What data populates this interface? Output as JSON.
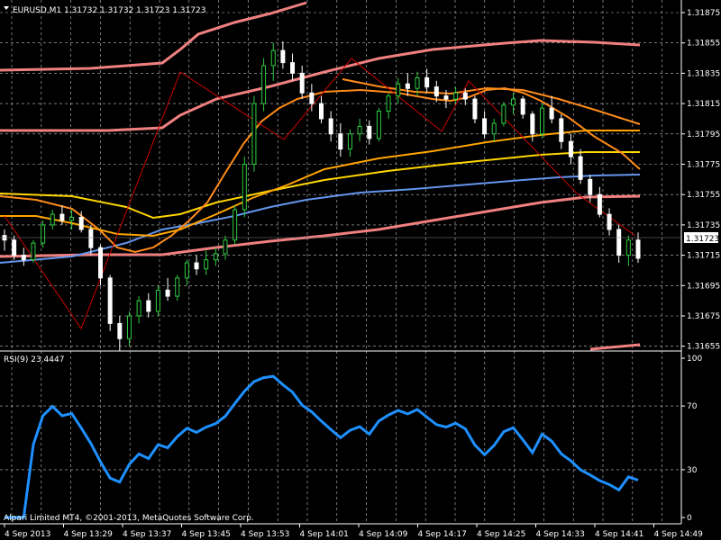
{
  "header": {
    "dropdown_icon": "triangle-down-icon",
    "text": "EURUSD,M1  1.31732 1.31732 1.31723 1.31723"
  },
  "rsi": {
    "label": "RSI(9) 23.4447",
    "value": 23.4447,
    "levels": [
      30,
      70
    ],
    "scale": [
      "100",
      "70",
      "30",
      "0"
    ]
  },
  "copyright": "Alpari Limited MT4, ©2001-2013, MetaQuotes Software Corp.",
  "price_axis": [
    "1.31875",
    "1.31855",
    "1.31835",
    "1.31815",
    "1.31795",
    "1.31775",
    "1.31755",
    "1.31735",
    "1.31715",
    "1.31695",
    "1.31675",
    "1.31655"
  ],
  "current_price": "1.31723",
  "time_axis": [
    "4 Sep 2013",
    "4 Sep 13:29",
    "4 Sep 13:37",
    "4 Sep 13:45",
    "4 Sep 13:53",
    "4 Sep 14:01",
    "4 Sep 14:09",
    "4 Sep 14:17",
    "4 Sep 14:25",
    "4 Sep 14:33",
    "4 Sep 14:41",
    "4 Sep 14:49"
  ],
  "colors": {
    "background": "#000000",
    "grid": "#c0c0c0",
    "bull_candle": "#2ecc40",
    "bear_candle": "#ffffff",
    "rsi_line": "#1e90ff",
    "zigzag": "#cc0000",
    "bands": "#f08080",
    "ma_orange": "#ff8c1a",
    "ma_gold": "#ffd700",
    "ma_blue": "#6495ed"
  },
  "chart_data": {
    "type": "candlestick",
    "symbol": "EURUSD",
    "timeframe": "M1",
    "ylim": [
      1.31645,
      1.31885
    ],
    "candles_ohlc": [
      [
        1.31738,
        1.31742,
        1.31728,
        1.31735
      ],
      [
        1.31735,
        1.31738,
        1.31722,
        1.31725
      ],
      [
        1.31725,
        1.3173,
        1.31718,
        1.31722
      ],
      [
        1.31722,
        1.31735,
        1.3172,
        1.31733
      ],
      [
        1.31733,
        1.31748,
        1.3173,
        1.31745
      ],
      [
        1.31745,
        1.31755,
        1.31742,
        1.31752
      ],
      [
        1.31752,
        1.31758,
        1.31745,
        1.31748
      ],
      [
        1.31748,
        1.31755,
        1.31742,
        1.3175
      ],
      [
        1.3175,
        1.31754,
        1.3174,
        1.31742
      ],
      [
        1.31742,
        1.31745,
        1.31725,
        1.3173
      ],
      [
        1.3173,
        1.31732,
        1.31705,
        1.3171
      ],
      [
        1.3171,
        1.31712,
        1.31675,
        1.3168
      ],
      [
        1.3168,
        1.31685,
        1.31662,
        1.3167
      ],
      [
        1.3167,
        1.31688,
        1.31665,
        1.31685
      ],
      [
        1.31685,
        1.31698,
        1.3168,
        1.31695
      ],
      [
        1.31695,
        1.317,
        1.31684,
        1.31688
      ],
      [
        1.31688,
        1.31705,
        1.31685,
        1.31702
      ],
      [
        1.31702,
        1.3171,
        1.31695,
        1.31698
      ],
      [
        1.31698,
        1.31712,
        1.31695,
        1.3171
      ],
      [
        1.3171,
        1.31722,
        1.31705,
        1.3172
      ],
      [
        1.3172,
        1.31725,
        1.31712,
        1.31716
      ],
      [
        1.31716,
        1.31728,
        1.31712,
        1.31722
      ],
      [
        1.31722,
        1.3173,
        1.31718,
        1.31726
      ],
      [
        1.31726,
        1.31738,
        1.31722,
        1.31735
      ],
      [
        1.31735,
        1.31758,
        1.31732,
        1.31755
      ],
      [
        1.31755,
        1.3179,
        1.3175,
        1.31785
      ],
      [
        1.31785,
        1.3183,
        1.3178,
        1.31825
      ],
      [
        1.31825,
        1.31855,
        1.3182,
        1.3185
      ],
      [
        1.3185,
        1.31865,
        1.3184,
        1.3186
      ],
      [
        1.3186,
        1.31866,
        1.31848,
        1.31852
      ],
      [
        1.31852,
        1.31858,
        1.3184,
        1.31845
      ],
      [
        1.31845,
        1.3185,
        1.31828,
        1.31832
      ],
      [
        1.31832,
        1.31838,
        1.3182,
        1.31825
      ],
      [
        1.31825,
        1.3183,
        1.31812,
        1.31815
      ],
      [
        1.31815,
        1.3182,
        1.318,
        1.31805
      ],
      [
        1.31805,
        1.31812,
        1.3179,
        1.31795
      ],
      [
        1.31795,
        1.31808,
        1.3179,
        1.31805
      ],
      [
        1.31805,
        1.31815,
        1.318,
        1.3181
      ],
      [
        1.3181,
        1.31814,
        1.31798,
        1.31802
      ],
      [
        1.31802,
        1.31822,
        1.318,
        1.3182
      ],
      [
        1.3182,
        1.31832,
        1.31815,
        1.3183
      ],
      [
        1.3183,
        1.31842,
        1.31825,
        1.31838
      ],
      [
        1.31838,
        1.31845,
        1.3183,
        1.31835
      ],
      [
        1.31835,
        1.31846,
        1.3183,
        1.31842
      ],
      [
        1.31842,
        1.31848,
        1.31832,
        1.31836
      ],
      [
        1.31836,
        1.3184,
        1.31826,
        1.3183
      ],
      [
        1.3183,
        1.31834,
        1.31822,
        1.31828
      ],
      [
        1.31828,
        1.31836,
        1.31825,
        1.31832
      ],
      [
        1.31832,
        1.31835,
        1.31824,
        1.31828
      ],
      [
        1.31828,
        1.3183,
        1.31812,
        1.31815
      ],
      [
        1.31815,
        1.3182,
        1.31802,
        1.31805
      ],
      [
        1.31805,
        1.31815,
        1.318,
        1.31812
      ],
      [
        1.31812,
        1.31826,
        1.3181,
        1.31824
      ],
      [
        1.31824,
        1.31832,
        1.31818,
        1.31828
      ],
      [
        1.31828,
        1.3183,
        1.31815,
        1.31818
      ],
      [
        1.31818,
        1.3182,
        1.318,
        1.31805
      ],
      [
        1.31805,
        1.31825,
        1.31802,
        1.31822
      ],
      [
        1.31822,
        1.3183,
        1.31812,
        1.31815
      ],
      [
        1.31815,
        1.31818,
        1.31795,
        1.318
      ],
      [
        1.318,
        1.31805,
        1.31785,
        1.3179
      ],
      [
        1.3179,
        1.31795,
        1.31772,
        1.31775
      ],
      [
        1.31775,
        1.31778,
        1.3176,
        1.31765
      ],
      [
        1.31765,
        1.3177,
        1.3175,
        1.31752
      ],
      [
        1.31752,
        1.31756,
        1.31738,
        1.31742
      ],
      [
        1.31742,
        1.31745,
        1.3172,
        1.31725
      ],
      [
        1.31725,
        1.31738,
        1.31718,
        1.31735
      ],
      [
        1.31735,
        1.3174,
        1.3172,
        1.31723
      ]
    ]
  }
}
